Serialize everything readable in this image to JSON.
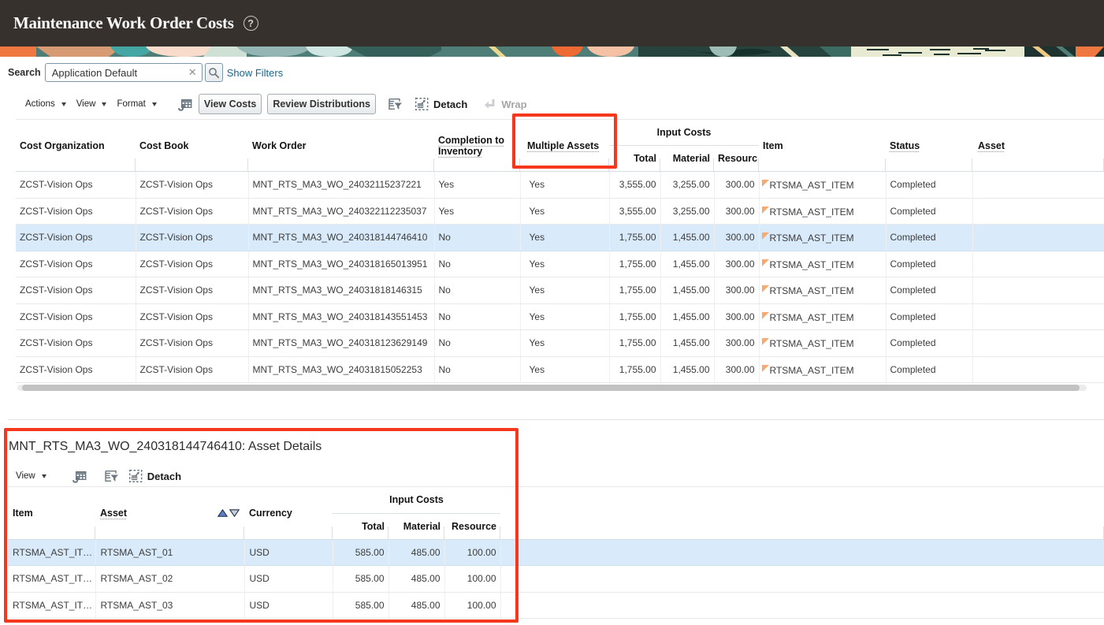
{
  "header": {
    "title": "Maintenance Work Order Costs"
  },
  "search": {
    "label": "Search",
    "value": "Application Default",
    "clear_icon": "✕",
    "show_filters": "Show Filters"
  },
  "toolbar": {
    "actions": "Actions",
    "view": "View",
    "format": "Format",
    "view_costs": "View Costs",
    "review_distributions": "Review Distributions",
    "detach": "Detach",
    "wrap": "Wrap"
  },
  "main_table": {
    "columns": {
      "cost_organization": "Cost Organization",
      "cost_book": "Cost Book",
      "work_order": "Work Order",
      "completion_to_inventory": "Completion to Inventory",
      "multiple_assets": "Multiple Assets",
      "input_costs": "Input Costs",
      "total": "Total",
      "material": "Material",
      "resource": "Resourc",
      "item": "Item",
      "status": "Status",
      "asset": "Asset"
    },
    "selected_index": 2,
    "rows": [
      [
        "ZCST-Vision Ops",
        "ZCST-Vision Ops",
        "MNT_RTS_MA3_WO_24032115237221",
        "Yes",
        "Yes",
        "3,555.00",
        "3,255.00",
        "300.00",
        "RTSMA_AST_ITEM",
        "Completed",
        ""
      ],
      [
        "ZCST-Vision Ops",
        "ZCST-Vision Ops",
        "MNT_RTS_MA3_WO_240322112235037",
        "Yes",
        "Yes",
        "3,555.00",
        "3,255.00",
        "300.00",
        "RTSMA_AST_ITEM",
        "Completed",
        ""
      ],
      [
        "ZCST-Vision Ops",
        "ZCST-Vision Ops",
        "MNT_RTS_MA3_WO_240318144746410",
        "No",
        "Yes",
        "1,755.00",
        "1,455.00",
        "300.00",
        "RTSMA_AST_ITEM",
        "Completed",
        ""
      ],
      [
        "ZCST-Vision Ops",
        "ZCST-Vision Ops",
        "MNT_RTS_MA3_WO_240318165013951",
        "No",
        "Yes",
        "1,755.00",
        "1,455.00",
        "300.00",
        "RTSMA_AST_ITEM",
        "Completed",
        ""
      ],
      [
        "ZCST-Vision Ops",
        "ZCST-Vision Ops",
        "MNT_RTS_MA3_WO_24031818146315",
        "No",
        "Yes",
        "1,755.00",
        "1,455.00",
        "300.00",
        "RTSMA_AST_ITEM",
        "Completed",
        ""
      ],
      [
        "ZCST-Vision Ops",
        "ZCST-Vision Ops",
        "MNT_RTS_MA3_WO_240318143551453",
        "No",
        "Yes",
        "1,755.00",
        "1,455.00",
        "300.00",
        "RTSMA_AST_ITEM",
        "Completed",
        ""
      ],
      [
        "ZCST-Vision Ops",
        "ZCST-Vision Ops",
        "MNT_RTS_MA3_WO_240318123629149",
        "No",
        "Yes",
        "1,755.00",
        "1,455.00",
        "300.00",
        "RTSMA_AST_ITEM",
        "Completed",
        ""
      ],
      [
        "ZCST-Vision Ops",
        "ZCST-Vision Ops",
        "MNT_RTS_MA3_WO_24031815052253",
        "No",
        "Yes",
        "1,755.00",
        "1,455.00",
        "300.00",
        "RTSMA_AST_ITEM",
        "Completed",
        ""
      ]
    ]
  },
  "detail_section": {
    "title": "MNT_RTS_MA3_WO_240318144746410: Asset Details",
    "toolbar": {
      "view": "View",
      "detach": "Detach"
    },
    "columns": {
      "item": "Item",
      "asset": "Asset",
      "currency": "Currency",
      "input_costs": "Input Costs",
      "total": "Total",
      "material": "Material",
      "resource": "Resource"
    },
    "selected_index": 0,
    "rows": [
      [
        "RTSMA_AST_IT…",
        "RTSMA_AST_01",
        "USD",
        "585.00",
        "485.00",
        "100.00",
        ""
      ],
      [
        "RTSMA_AST_IT…",
        "RTSMA_AST_02",
        "USD",
        "585.00",
        "485.00",
        "100.00",
        ""
      ],
      [
        "RTSMA_AST_IT…",
        "RTSMA_AST_03",
        "USD",
        "585.00",
        "485.00",
        "100.00",
        ""
      ]
    ]
  },
  "annotations": {
    "color": "#f5381d"
  }
}
